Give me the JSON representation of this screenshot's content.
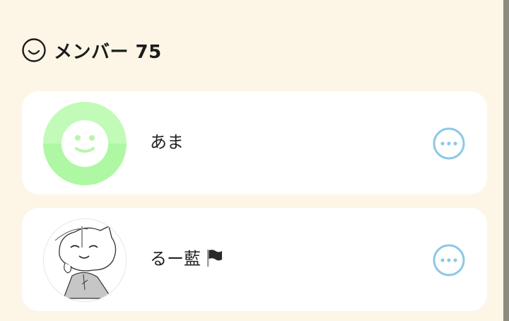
{
  "members_header": {
    "icon": "smiley-face-icon",
    "title": "メンバー 75"
  },
  "members": [
    {
      "name": "あま",
      "avatar": "default-smiley-avatar",
      "avatar_colors": {
        "top": "#c2fbb7",
        "bottom": "#aef8a3",
        "face": "#ffffff",
        "mouth": "#b9f5ac"
      },
      "more_icon": "more-options-icon"
    },
    {
      "name": "るー藍",
      "name_suffix_icon": "black-flag-icon",
      "avatar": "drawn-character-avatar",
      "more_icon": "more-options-icon"
    }
  ],
  "colors": {
    "background": "#fdf6e6",
    "card": "#ffffff",
    "accent": "#8ec8e8"
  }
}
